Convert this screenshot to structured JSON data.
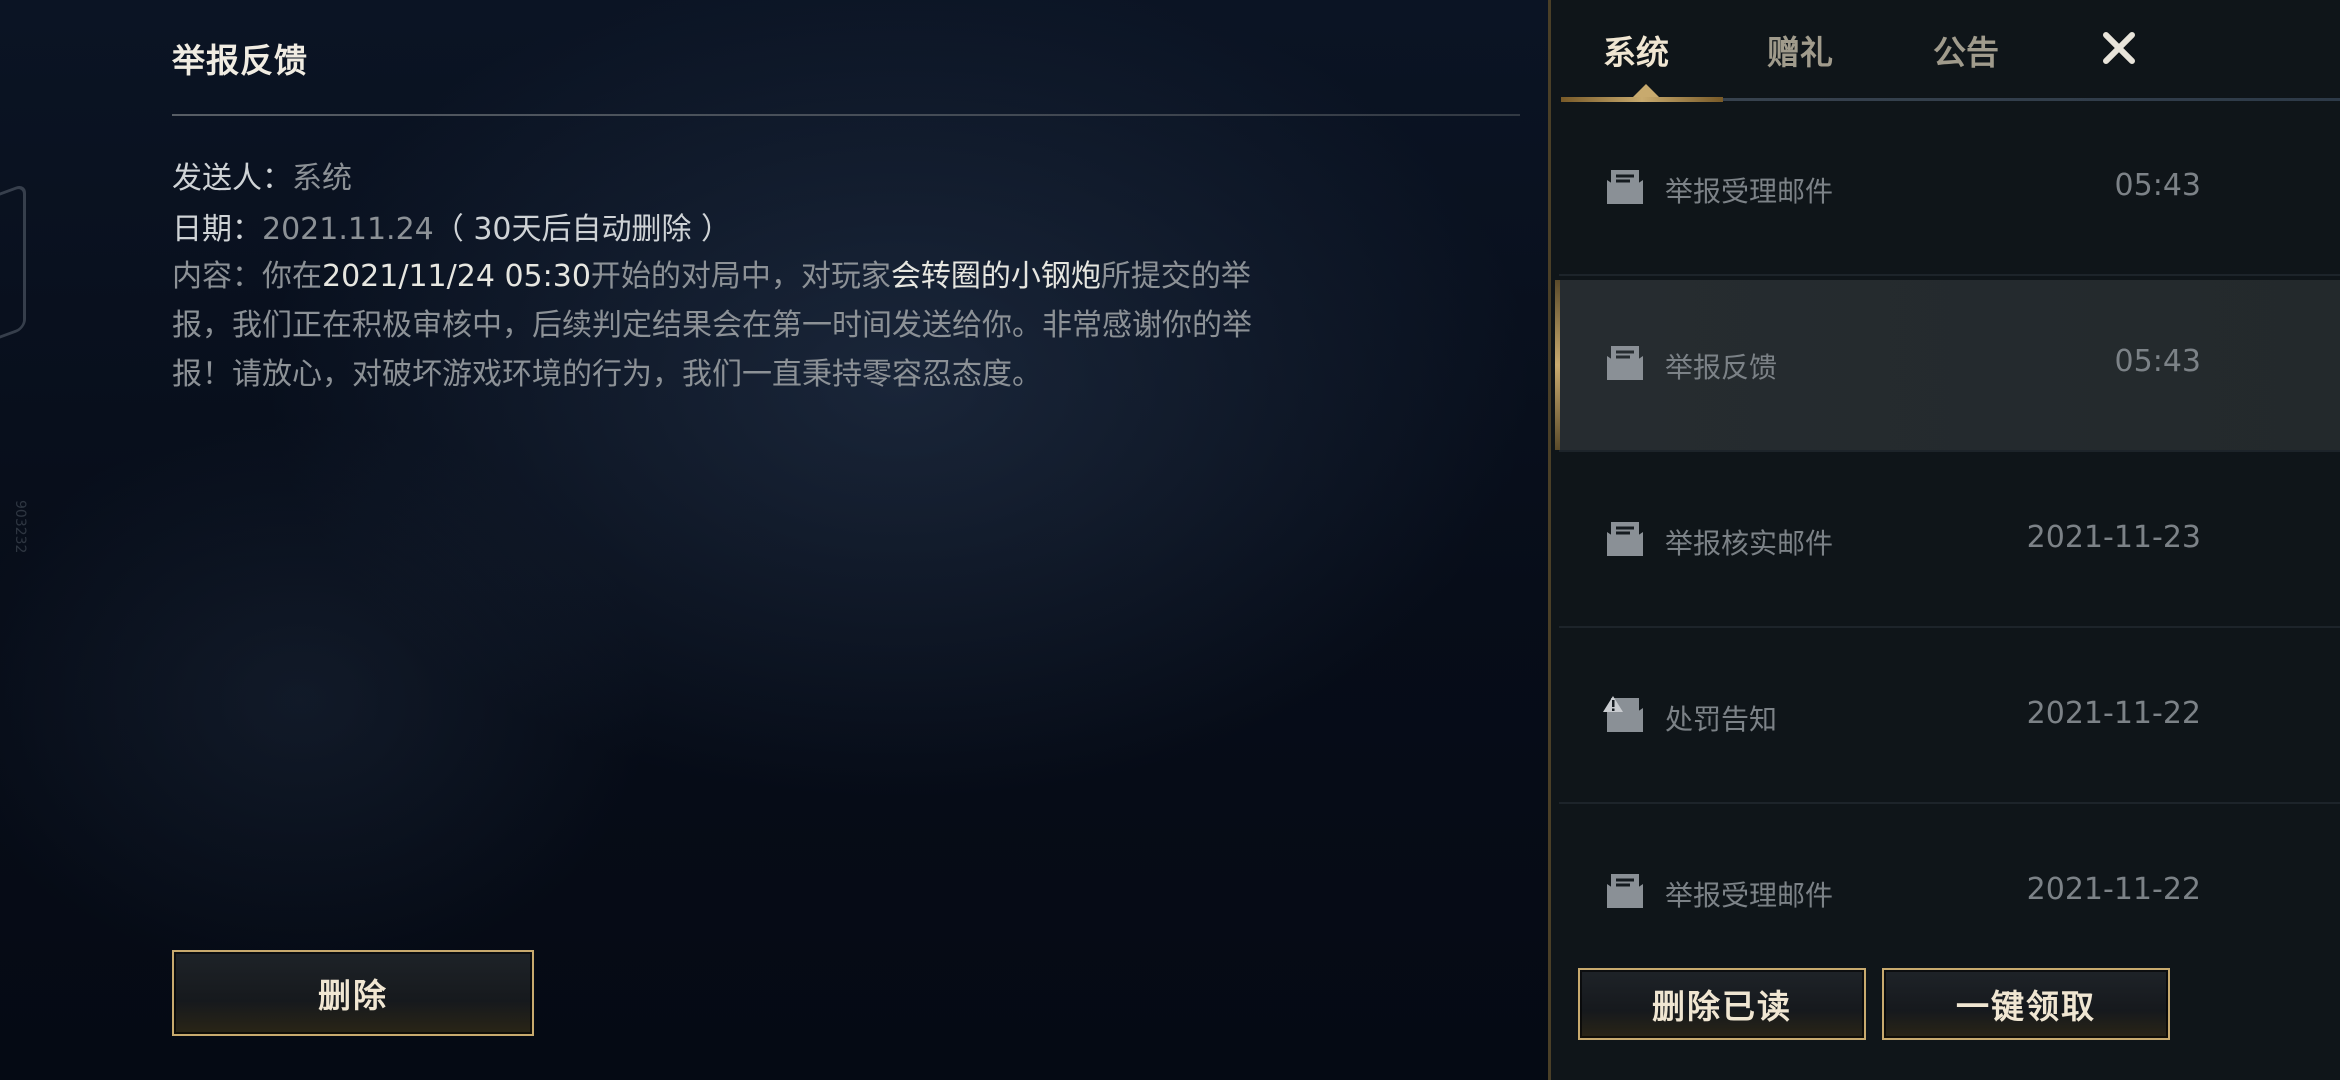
{
  "detail": {
    "title": "举报反馈",
    "sender_label": "发送人：",
    "sender_value": "系统",
    "date_label": "日期：",
    "date_value": "2021.11.24",
    "date_note": "（ 30天后自动删除 ）",
    "content_label": "内容：",
    "content_part1": "你在",
    "content_datetime": "2021/11/24 05:30",
    "content_part2": "开始的对局中，对玩家",
    "content_player": "会转圈的小钢炮",
    "content_part3": "所提交的举报，我们正在积极审核中，后续判定结果会在第一时间发送给你。非常感谢你的举报！请放心，对破坏游戏环境的行为，我们一直秉持零容忍态度。",
    "delete_label": "删除"
  },
  "side_digits": "903232",
  "tabs": [
    {
      "label": "系统",
      "active": true
    },
    {
      "label": "赠礼",
      "active": false
    },
    {
      "label": "公告",
      "active": false
    }
  ],
  "mails": [
    {
      "subject": "举报受理邮件",
      "time": "05:43",
      "icon": "envelope-icon",
      "selected": false
    },
    {
      "subject": "举报反馈",
      "time": "05:43",
      "icon": "envelope-icon",
      "selected": true
    },
    {
      "subject": "举报核实邮件",
      "time": "2021-11-23",
      "icon": "envelope-icon",
      "selected": false
    },
    {
      "subject": "处罚告知",
      "time": "2021-11-22",
      "icon": "warning-envelope-icon",
      "selected": false
    },
    {
      "subject": "举报受理邮件",
      "time": "2021-11-22",
      "icon": "envelope-icon",
      "selected": false
    }
  ],
  "footer": {
    "delete_read_label": "删除已读",
    "claim_all_label": "一键领取"
  },
  "colors": {
    "gold": "#c8aa6e",
    "panel_bg": "#0f1519",
    "text_muted": "#7c8287",
    "text_bright": "#f0e6d2"
  }
}
